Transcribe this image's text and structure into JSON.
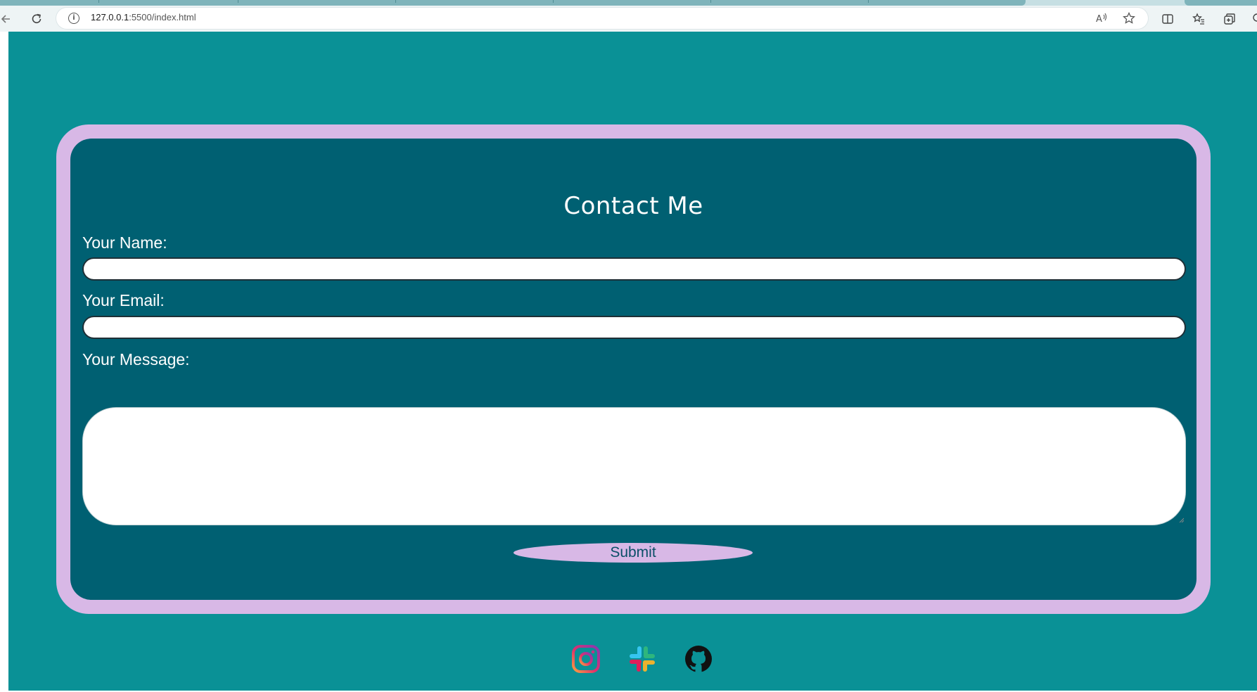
{
  "browser": {
    "url_host": "127.0.0.1",
    "url_rest": ":5500/index.html"
  },
  "form": {
    "title": "Contact Me",
    "name_label": "Your Name:",
    "name_value": "",
    "email_label": "Your Email:",
    "email_value": "",
    "message_label": "Your Message:",
    "message_value": "",
    "submit_label": "Submit"
  },
  "socials": [
    {
      "name": "instagram-icon"
    },
    {
      "name": "slack-icon"
    },
    {
      "name": "github-icon"
    }
  ],
  "colors": {
    "page_bg": "#0a9196",
    "frame": "#d8b8e6",
    "card": "#006072",
    "submit_text": "#0a4f68"
  }
}
